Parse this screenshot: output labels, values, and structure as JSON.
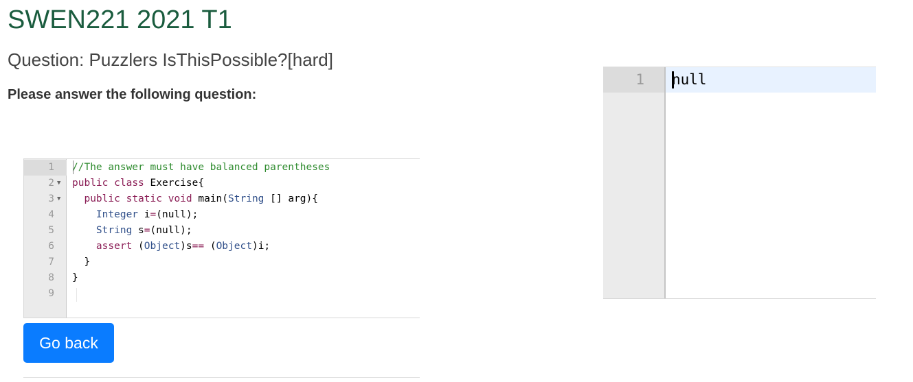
{
  "header": {
    "title": "SWEN221 2021 T1",
    "question": "Question: Puzzlers IsThisPossible?[hard]",
    "instructions": "Please answer the following question:"
  },
  "code_editor": {
    "lines": [
      {
        "number": "1",
        "fold": false
      },
      {
        "number": "2",
        "fold": true
      },
      {
        "number": "3",
        "fold": true
      },
      {
        "number": "4",
        "fold": false
      },
      {
        "number": "5",
        "fold": false
      },
      {
        "number": "6",
        "fold": false
      },
      {
        "number": "7",
        "fold": false
      },
      {
        "number": "8",
        "fold": false
      },
      {
        "number": "9",
        "fold": false
      }
    ],
    "code": [
      [
        {
          "t": "//The answer must have balanced parentheses",
          "c": "comment"
        }
      ],
      [
        {
          "t": "public",
          "c": "keyword"
        },
        {
          "t": " "
        },
        {
          "t": "class",
          "c": "keyword"
        },
        {
          "t": " Exercise{"
        }
      ],
      [
        {
          "t": "  "
        },
        {
          "t": "public",
          "c": "keyword"
        },
        {
          "t": " "
        },
        {
          "t": "static",
          "c": "keyword"
        },
        {
          "t": " "
        },
        {
          "t": "void",
          "c": "keyword"
        },
        {
          "t": " main("
        },
        {
          "t": "String",
          "c": "type"
        },
        {
          "t": " [] arg){"
        }
      ],
      [
        {
          "t": "    "
        },
        {
          "t": "Integer",
          "c": "type"
        },
        {
          "t": " i"
        },
        {
          "t": "=",
          "c": "op"
        },
        {
          "t": "(null);"
        }
      ],
      [
        {
          "t": "    "
        },
        {
          "t": "String",
          "c": "type"
        },
        {
          "t": " s"
        },
        {
          "t": "=",
          "c": "op"
        },
        {
          "t": "(null);"
        }
      ],
      [
        {
          "t": "    "
        },
        {
          "t": "assert",
          "c": "keyword"
        },
        {
          "t": " ("
        },
        {
          "t": "Object",
          "c": "type"
        },
        {
          "t": ")s"
        },
        {
          "t": "==",
          "c": "op"
        },
        {
          "t": " ("
        },
        {
          "t": "Object",
          "c": "type"
        },
        {
          "t": ")i;"
        }
      ],
      [
        {
          "t": "  }"
        }
      ],
      [
        {
          "t": "}"
        }
      ],
      [
        {
          "t": ""
        }
      ]
    ]
  },
  "buttons": {
    "go_back": "Go back"
  },
  "answer_editor": {
    "line_number": "1",
    "value": "null"
  },
  "colors": {
    "title": "#1a5c3e",
    "button": "#0a7cff",
    "comment": "#2e8b2e",
    "keyword": "#8b1e56",
    "type": "#31508a"
  }
}
